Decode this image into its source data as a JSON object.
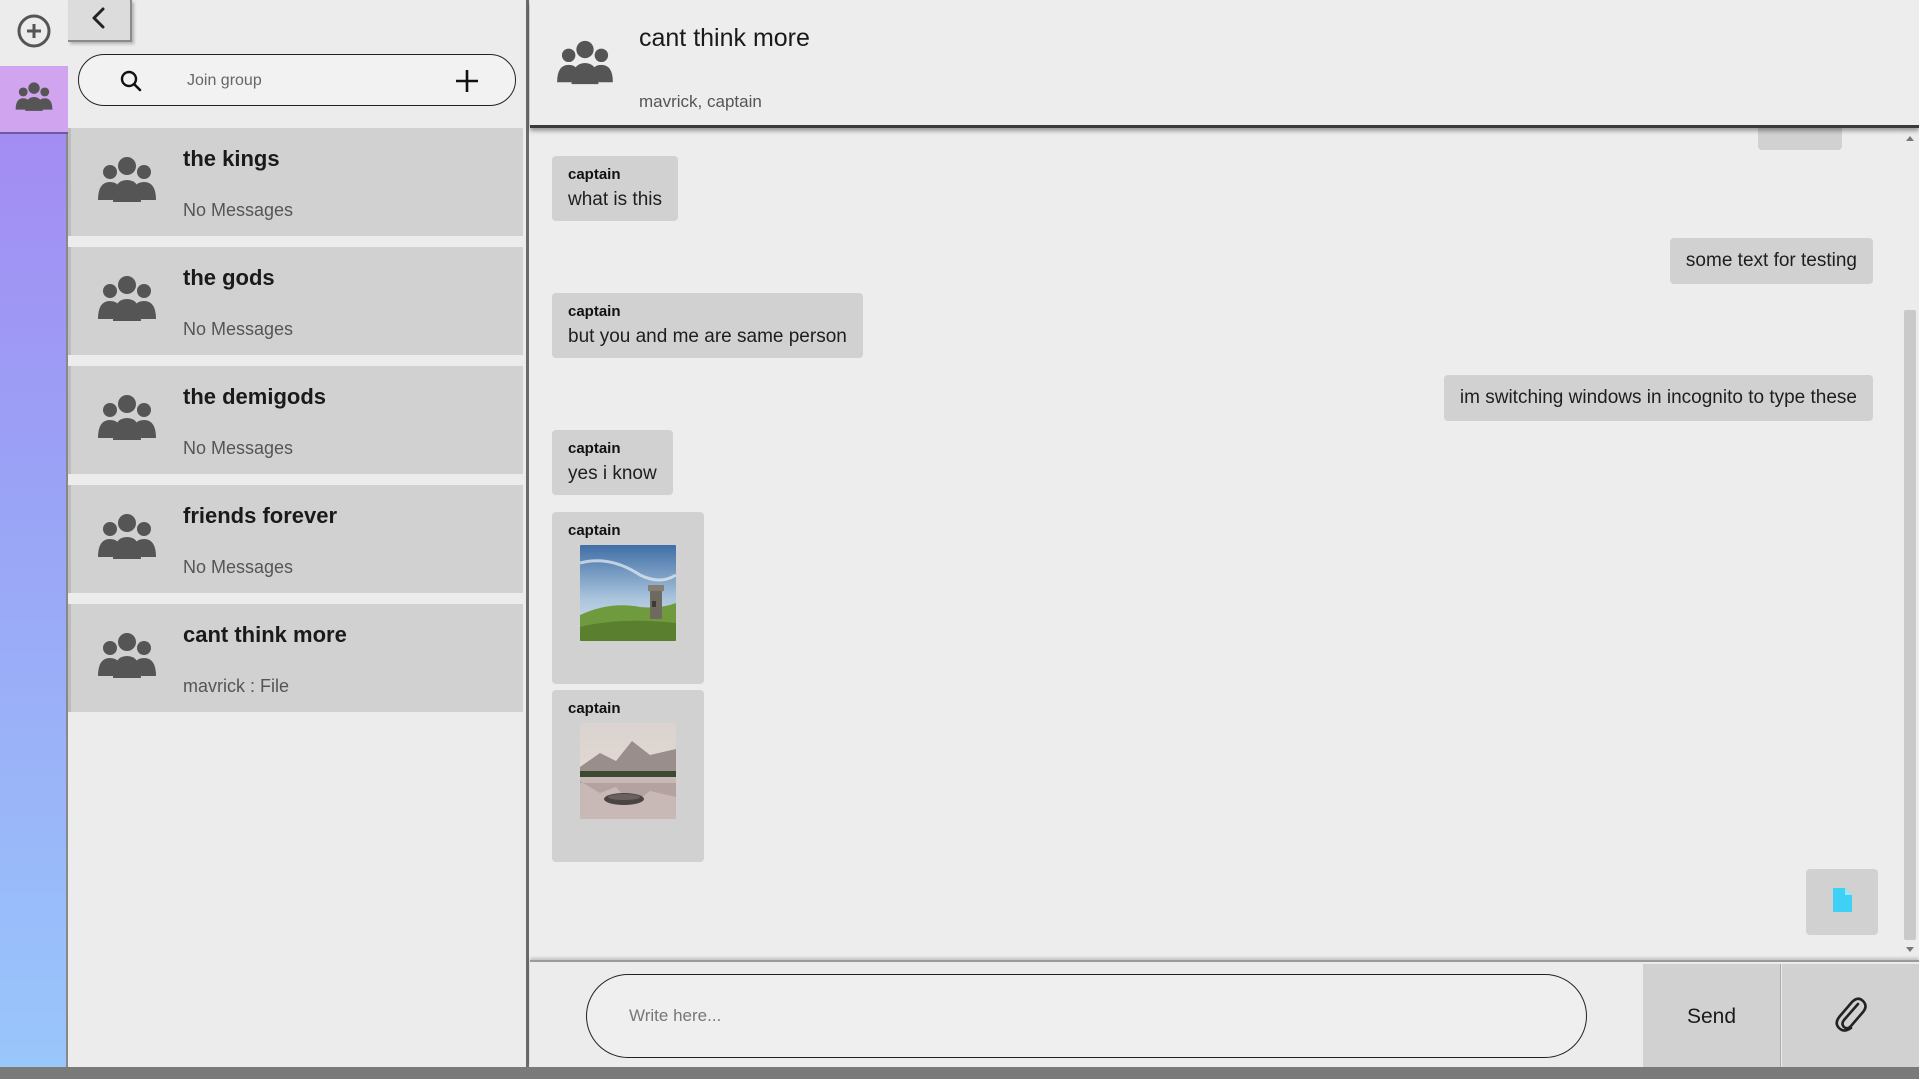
{
  "rail": {
    "add_icon": "plus-circle-icon",
    "groups_icon": "users-icon"
  },
  "sidebar": {
    "back_icon": "chevron-left-icon",
    "search": {
      "placeholder": "Join group",
      "icon": "search-icon",
      "add_icon": "plus-icon"
    },
    "groups": [
      {
        "name": "the kings",
        "last": "No Messages"
      },
      {
        "name": "the gods",
        "last": "No Messages"
      },
      {
        "name": "the demigods",
        "last": "No Messages"
      },
      {
        "name": "friends forever",
        "last": "No Messages"
      },
      {
        "name": "cant think more",
        "last": "mavrick : File"
      }
    ]
  },
  "chat": {
    "title": "cant think more",
    "members": "mavrick, captain",
    "messages": [
      {
        "direction": "in",
        "sender": "captain",
        "text": "what is this"
      },
      {
        "direction": "out",
        "text": "some text for testing"
      },
      {
        "direction": "in",
        "sender": "captain",
        "text": "but you and me are same person"
      },
      {
        "direction": "out",
        "text": "im switching windows in incognito to type these"
      },
      {
        "direction": "in",
        "sender": "captain",
        "text": "yes i know"
      },
      {
        "direction": "in",
        "sender": "captain",
        "type": "image",
        "image": "landscape-tower"
      },
      {
        "direction": "in",
        "sender": "captain",
        "type": "image",
        "image": "landscape-lake"
      },
      {
        "direction": "out",
        "type": "file",
        "icon": "file-icon"
      }
    ]
  },
  "composer": {
    "placeholder": "Write here...",
    "send_label": "Send",
    "attach_icon": "paperclip-icon"
  },
  "colors": {
    "rail_top": "#a784f1",
    "rail_bottom": "#99c6fb",
    "active_rail": "#d1a4f0",
    "bubble": "#d1d1d1",
    "background": "#ededed",
    "file_icon": "#3fd0f5"
  }
}
